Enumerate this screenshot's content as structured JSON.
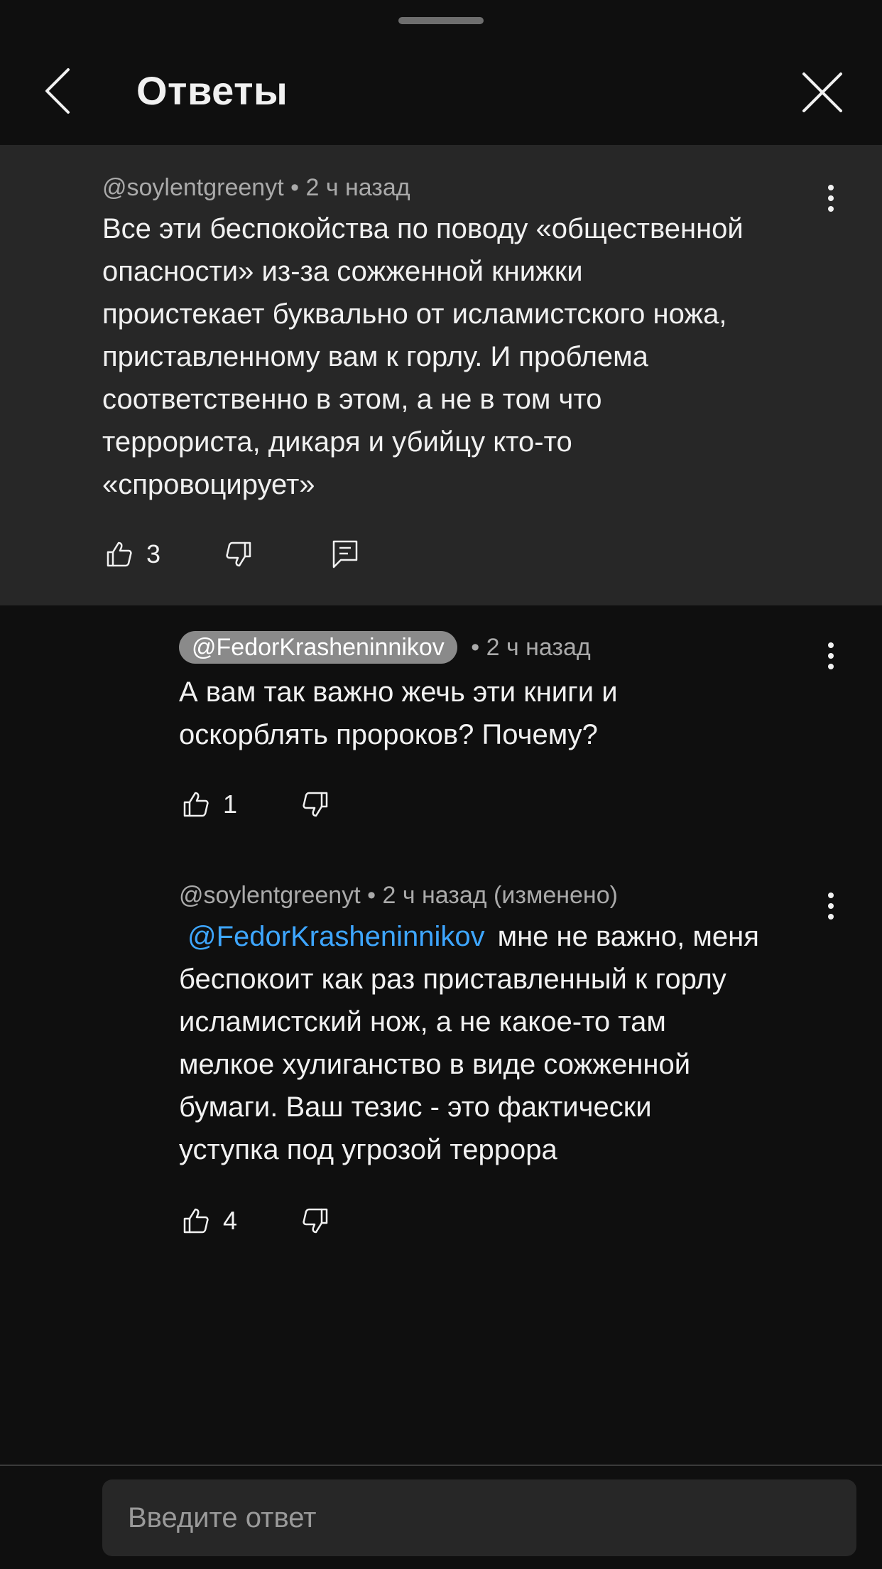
{
  "header": {
    "title": "Ответы"
  },
  "parent_comment": {
    "author": "@soylentgreenyt",
    "time": "• 2 ч назад",
    "lines": [
      "Все эти беспокойства по поводу «общественной",
      "опасности» из-за сожженной книжки",
      "проистекает буквально от исламистского ножа,",
      "приставленному вам к горлу. И проблема",
      "соответственно в этом, а не в том что",
      "террориста, дикаря и убийцу кто-то",
      "«спровоцирует»"
    ],
    "likes": "3"
  },
  "replies": [
    {
      "author": "@FedorKrasheninnikov",
      "time": "• 2 ч назад",
      "lines": [
        "А вам так важно жечь эти книги и",
        "оскорблять пророков? Почему?"
      ],
      "likes": "1"
    },
    {
      "author": "@soylentgreenyt",
      "time": "• 2 ч назад (изменено)",
      "mention": "@FedorKrasheninnikov",
      "first_line_rest": "мне не важно, меня",
      "lines": [
        "беспокоит как раз приставленный к горлу",
        "исламистский нож, а не какое-то там",
        "мелкое хулиганство в виде сожженной",
        "бумаги. Ваш тезис - это фактически",
        "уступка под угрозой террора"
      ],
      "likes": "4"
    }
  ],
  "reply_input": {
    "placeholder": "Введите ответ"
  },
  "icons": {
    "back": "chevron-left-icon",
    "close": "close-icon",
    "more": "more-vertical-icon",
    "like": "thumbs-up-icon",
    "dislike": "thumbs-down-icon",
    "reply": "reply-comment-icon"
  },
  "colors": {
    "background": "#0f0f0f",
    "parent_highlight": "#272727",
    "mention": "#3ea6ff",
    "secondary_text": "#aaaaaa"
  }
}
